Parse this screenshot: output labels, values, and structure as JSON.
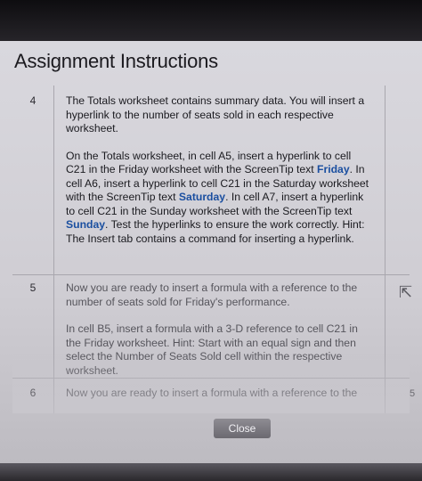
{
  "dialog": {
    "title": "Assignment Instructions",
    "close_label": "Close"
  },
  "steps": [
    {
      "number": "4",
      "intro": "The Totals worksheet contains summary data. You will insert a hyperlink to the number of seats sold in each respective worksheet.",
      "detail_1": "On the Totals worksheet, in cell A5, insert a hyperlink to cell C21 in the Friday worksheet with the ScreenTip text ",
      "screentip_1": "Friday",
      "detail_2": ". In cell A6, insert a hyperlink to cell C21 in the Saturday worksheet with the ScreenTip text ",
      "screentip_2": "Saturday",
      "detail_3": ". In cell A7, insert a hyperlink to cell C21 in the Sunday worksheet with the ScreenTip text ",
      "screentip_3": "Sunday",
      "detail_4": ". Test the hyperlinks to ensure the work correctly. Hint: The Insert tab contains a command for inserting a hyperlink."
    },
    {
      "number": "5",
      "intro": "Now you are ready to insert a formula with a reference to the number of seats sold for Friday's performance.",
      "detail": "In cell B5, insert a formula with a 3-D reference to cell C21 in the Friday worksheet. Hint: Start with an equal sign and then select the Number of Seats Sold cell within the respective worksheet."
    },
    {
      "number": "6",
      "intro": "Now you are ready to insert a formula with a reference to the"
    }
  ],
  "side_number": "5"
}
